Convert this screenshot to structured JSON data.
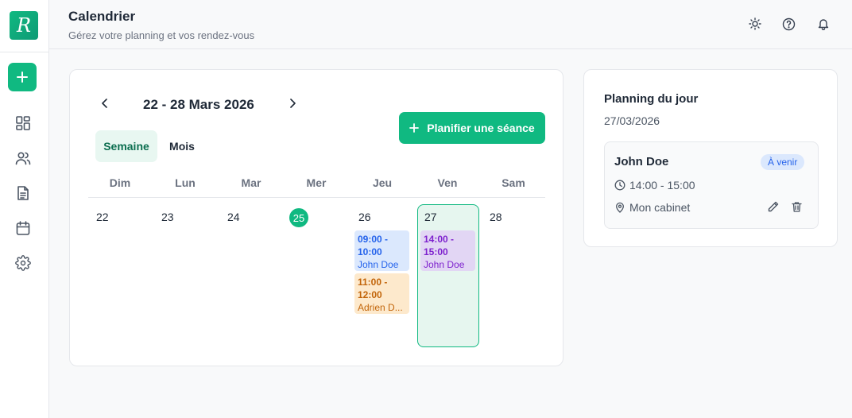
{
  "logo": {
    "letter": "R"
  },
  "sidebar": {
    "new_label": "+",
    "nav": [
      {
        "id": "dashboard",
        "icon": "dashboard-icon"
      },
      {
        "id": "patients",
        "icon": "users-icon"
      },
      {
        "id": "documents",
        "icon": "document-icon"
      },
      {
        "id": "calendar",
        "icon": "calendar-icon"
      },
      {
        "id": "settings",
        "icon": "gear-icon"
      }
    ]
  },
  "header": {
    "title": "Calendrier",
    "subtitle": "Gérez votre planning et vos rendez-vous",
    "icons": [
      "sun-icon",
      "help-icon",
      "bell-icon"
    ]
  },
  "calendar": {
    "range_label": "22 - 28 Mars 2026",
    "tabs": {
      "week": "Semaine",
      "month": "Mois"
    },
    "active_tab": "week",
    "plan_button": "Planifier une séance",
    "day_headers": [
      "Dim",
      "Lun",
      "Mar",
      "Mer",
      "Jeu",
      "Ven",
      "Sam"
    ],
    "day_numbers": [
      "22",
      "23",
      "24",
      "25",
      "26",
      "27",
      "28"
    ],
    "today_index": 3,
    "selected_index": 5,
    "events": [
      {
        "day_index": 4,
        "time": "09:00 - 10:00",
        "name": "John Doe",
        "color": "#2563eb",
        "bg": "#dbe8fd"
      },
      {
        "day_index": 4,
        "time": "11:00 - 12:00",
        "name": "Adrien D...",
        "color": "#c2650a",
        "bg": "#fde9cc"
      },
      {
        "day_index": 5,
        "time": "14:00 - 15:00",
        "name": "John Doe",
        "color": "#7e22ce",
        "bg": "#e2d6f4"
      }
    ]
  },
  "day_planning": {
    "title": "Planning du jour",
    "date": "27/03/2026",
    "appointment": {
      "name": "John Doe",
      "status": "À venir",
      "time": "14:00 - 15:00",
      "location": "Mon cabinet"
    }
  },
  "colors": {
    "accent": "#10b981",
    "accent_light": "#e6f6ef",
    "status_blue": "#2563eb"
  }
}
